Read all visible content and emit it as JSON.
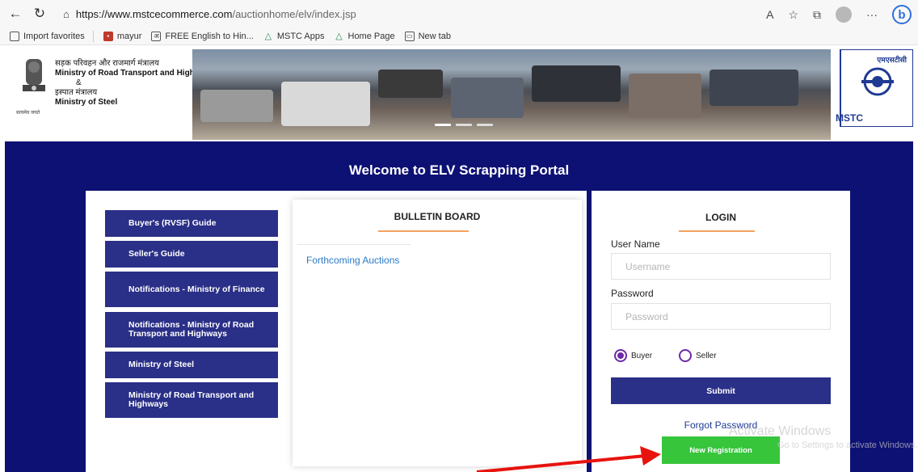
{
  "browser": {
    "url_host": "https://www.mstcecommerce.com",
    "url_path": "/auctionhome/elv/index.jsp",
    "favorites": [
      {
        "label": "Import favorites",
        "icon": "import-icon"
      },
      {
        "label": "mayur",
        "icon": "pdf-icon"
      },
      {
        "label": "FREE English to Hin...",
        "icon": "translate-icon"
      },
      {
        "label": "MSTC Apps",
        "icon": "triangle-icon"
      },
      {
        "label": "Home Page",
        "icon": "triangle-icon"
      },
      {
        "label": "New tab",
        "icon": "newtab-icon"
      }
    ]
  },
  "header": {
    "ministry_hindi": "सड़क परिवहन और राजमार्ग मंत्रालय",
    "ministry_road": "Ministry of Road Transport and Highways",
    "amp": "&",
    "steel_hindi": "इस्पात मंत्रालय",
    "ministry_steel": "Ministry of Steel",
    "emblem_caption": "सत्यमेव जयते",
    "mstc_hindi": "एमएसटीसी",
    "mstc_text": "MSTC"
  },
  "main": {
    "welcome": "Welcome to ELV Scrapping Portal",
    "guides": [
      "Buyer's (RVSF) Guide",
      "Seller's Guide",
      "Notifications - Ministry of Finance",
      "Notifications - Ministry of Road Transport and Highways",
      "Ministry of Steel",
      "Ministry of Road Transport and Highways"
    ],
    "bulletin": {
      "title": "BULLETIN BOARD",
      "link": "Forthcoming Auctions"
    },
    "login": {
      "title": "LOGIN",
      "username_label": "User Name",
      "username_placeholder": "Username",
      "password_label": "Password",
      "password_placeholder": "Password",
      "radio_buyer": "Buyer",
      "radio_seller": "Seller",
      "selected_role": "Buyer",
      "submit": "Submit",
      "forgot": "Forgot Password",
      "new_registration": "New Registration"
    }
  },
  "watermark": {
    "line1": "Activate Windows",
    "line2": "Go to Settings to activate Windows."
  },
  "colors": {
    "page_blue": "#0d1173",
    "button_blue": "#2a2f87",
    "new_reg_green": "#37c53c",
    "accent_orange": "#f4a261",
    "link_blue": "#2a7bc8"
  }
}
